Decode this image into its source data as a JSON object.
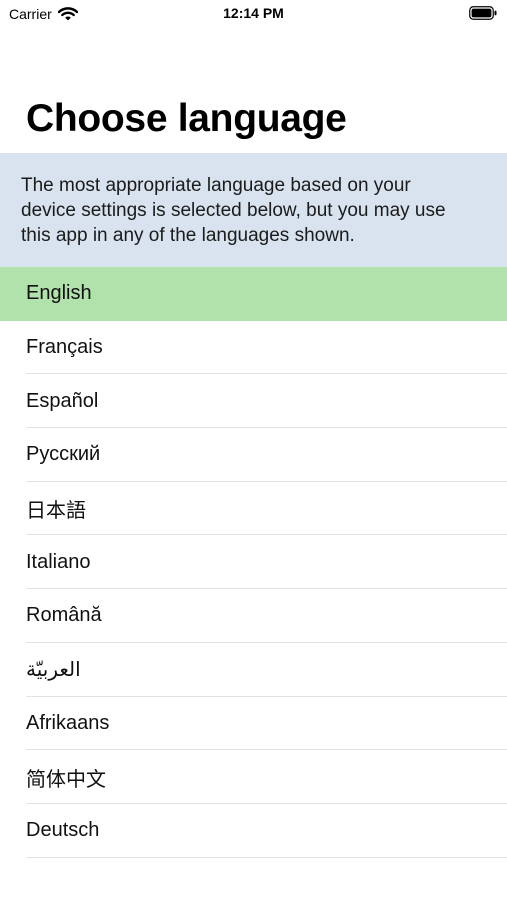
{
  "status_bar": {
    "carrier": "Carrier",
    "time": "12:14 PM",
    "wifi_icon": "wifi-icon",
    "battery_icon": "battery-icon"
  },
  "header": {
    "title": "Choose language"
  },
  "info": {
    "text": "The most appropriate language based on your device settings is selected below, but you may use this app in any of the languages shown."
  },
  "languages": {
    "selected": "English",
    "items": [
      {
        "label": "English"
      },
      {
        "label": "Français"
      },
      {
        "label": "Español"
      },
      {
        "label": "Русский"
      },
      {
        "label": "日本語"
      },
      {
        "label": "Italiano"
      },
      {
        "label": "Română"
      },
      {
        "label": "العربيّة"
      },
      {
        "label": "Afrikaans"
      },
      {
        "label": "简体中文"
      },
      {
        "label": "Deutsch"
      }
    ]
  },
  "colors": {
    "selected_row": "#b2e2ab",
    "info_banner": "#d8e3ef",
    "separator": "#e3e3e3"
  }
}
